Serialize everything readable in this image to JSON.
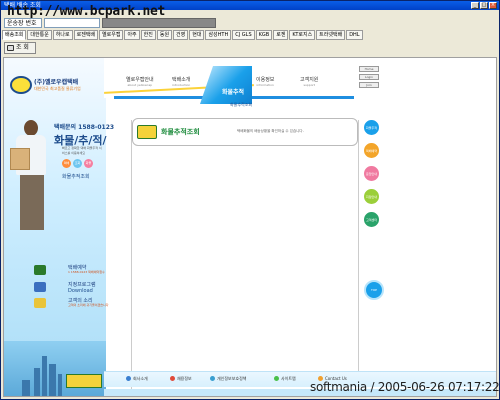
{
  "window": {
    "title": "택배 배송 조회",
    "buttons": [
      "_",
      "□",
      "×"
    ]
  },
  "address": {
    "watermark_url": "http://www.bcpark.net",
    "label": "운송장 번호",
    "value": ""
  },
  "tabs": [
    "배송조회",
    "대한통운",
    "하나로",
    "로젠택배",
    "옐로우캡",
    "아주",
    "한진",
    "동원",
    "건영",
    "현대",
    "삼성HTH",
    "CJ GLS",
    "KGB",
    "로젠",
    "KT로지스",
    "트라넷택배",
    "DHL"
  ],
  "search_button": "조 회",
  "site": {
    "logo_title": "(주)옐로우캡택배",
    "logo_sub": "대한민국 최고품질 물류기업",
    "phone": "택배문의 1588-0123",
    "big_title": "화물/추/적/",
    "big_desc": "빠르고 정확한 택배 화물추적 서비스를 이용하세요",
    "circles": [
      "택배",
      "조회",
      "화물"
    ],
    "track_link": "화물추적조회",
    "nav": [
      {
        "k": "옐로우캡안내",
        "e": "about yellowcap"
      },
      {
        "k": "택배소개",
        "e": "introduction"
      },
      {
        "k": "화물추적",
        "e": "tracking"
      },
      {
        "k": "이용정보",
        "e": "information"
      },
      {
        "k": "고객지원",
        "e": "support"
      }
    ],
    "subnav": "화물추적조회",
    "login": [
      "Home",
      "Login",
      "Join"
    ],
    "left_menu": [
      {
        "t1": "택배예약",
        "t2": "1 1588-0123 택배예약접수"
      },
      {
        "t1": "지정프로그램",
        "t2": "Download"
      },
      {
        "t1": "고객의 소리",
        "t2": "고객의 소리에 귀기울이겠습니다"
      }
    ],
    "panel_title": "화물추적조회",
    "panel_desc": "택배화물의 배송상황을 확인하실 수 있습니다.",
    "side_buttons": [
      "화물추적",
      "택배예약",
      "운임안내",
      "지점안내",
      "고객센터",
      "TOP"
    ],
    "footer_links": [
      "회사소개",
      "채용정보",
      "개인정보보호정책",
      "사이트맵",
      "Contact Us"
    ]
  },
  "stamp": "softmania / 2005-06-26 07:17:22"
}
